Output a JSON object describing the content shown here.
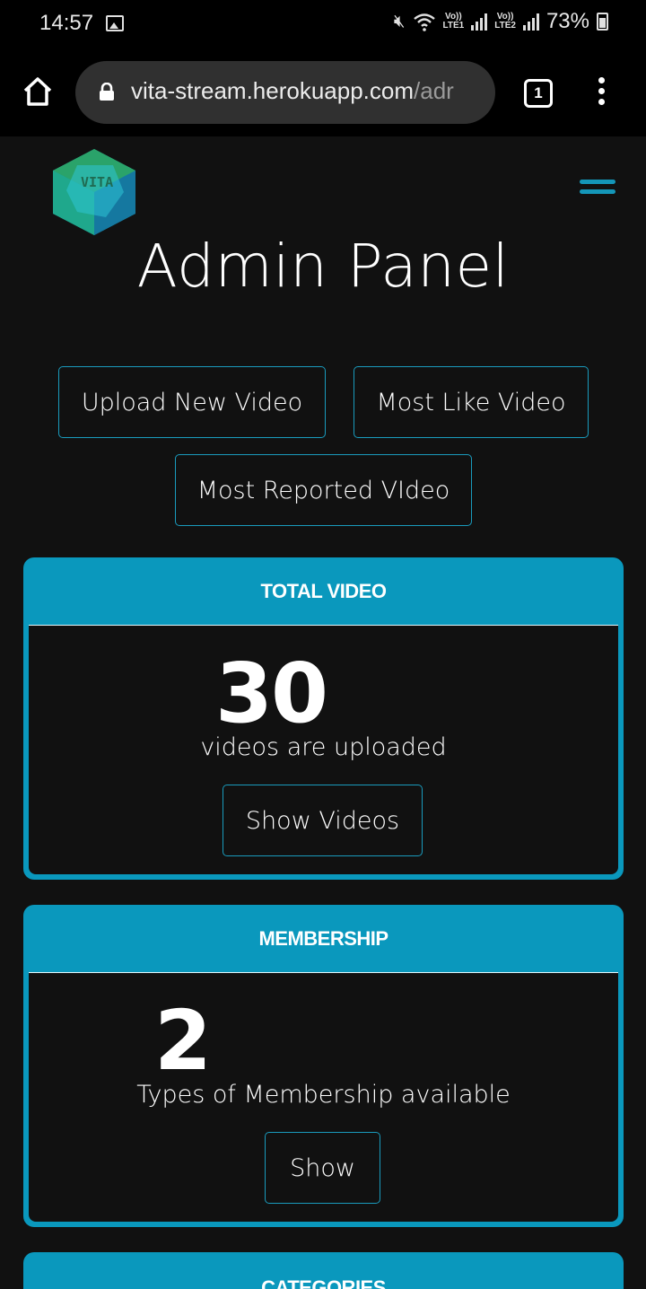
{
  "status_bar": {
    "time": "14:57",
    "battery": "73%",
    "sim1": "Vo))\nLTE1",
    "sim2": "Vo))\nLTE2"
  },
  "browser": {
    "url_host": "vita-stream.herokuapp.com",
    "url_path": "/adr",
    "tab_count": "1"
  },
  "header": {
    "logo_text": "VITA",
    "title": "Admin Panel"
  },
  "actions": {
    "upload": "Upload New Video",
    "most_liked": "Most Like Video",
    "most_reported": "Most Reported VIdeo"
  },
  "cards": {
    "video": {
      "title": "TOTAL VIDEO",
      "count": "30",
      "caption": "videos are uploaded",
      "button": "Show Videos"
    },
    "membership": {
      "title": "MEMBERSHIP",
      "count": "2",
      "caption": "Types of Membership available",
      "button": "Show"
    },
    "categories": {
      "title": "CATEGORIES"
    }
  },
  "colors": {
    "accent": "#0a98bd",
    "background": "#111111"
  }
}
